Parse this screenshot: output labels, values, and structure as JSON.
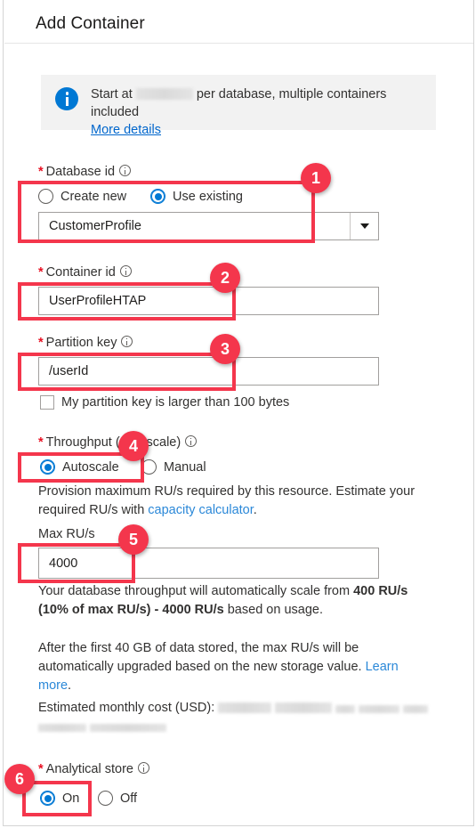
{
  "panel": {
    "title": "Add Container"
  },
  "info_banner": {
    "icon": "info-circle-icon",
    "text_before": "Start at",
    "redacted_price": "",
    "text_after": "per database, multiple containers included",
    "link_label": "More details"
  },
  "fields": {
    "database_id": {
      "label": "Database id",
      "required_marker": "*",
      "info_icon": "info-circle-icon",
      "options": [
        {
          "label": "Create new",
          "checked": false
        },
        {
          "label": "Use existing",
          "checked": true
        }
      ],
      "combo_value": "CustomerProfile",
      "combo_caret": "chevron-down-icon"
    },
    "container_id": {
      "label": "Container id",
      "required_marker": "*",
      "info_icon": "info-circle-icon",
      "value": "UserProfileHTAP"
    },
    "partition_key": {
      "label": "Partition key",
      "required_marker": "*",
      "info_icon": "info-circle-icon",
      "value": "/userId",
      "checkbox_label": "My partition key is larger than 100 bytes",
      "checkbox_checked": false
    },
    "throughput": {
      "label": "Throughput (Autoscale)",
      "required_marker": "*",
      "info_icon": "info-circle-icon",
      "options": [
        {
          "label": "Autoscale",
          "checked": true
        },
        {
          "label": "Manual",
          "checked": false
        }
      ],
      "helper_before": "Provision maximum RU/s required by this resource. Estimate your required RU/s with ",
      "helper_link": "capacity calculator",
      "helper_after": "."
    },
    "max_rus": {
      "label": "Max RU/s",
      "value": "4000",
      "helper_1": "Your database throughput will automatically scale from ",
      "helper_1_bold": "400 RU/s (10% of max RU/s) - 4000 RU/s",
      "helper_1_after": " based on usage.",
      "helper_2": "After the first 40 GB of data stored, the max RU/s will be automatically upgraded based on the new storage value. ",
      "helper_2_link": "Learn more",
      "helper_2_after": ".",
      "cost_label": "Estimated monthly cost (USD):",
      "cost_value_redacted": ""
    },
    "analytical_store": {
      "label": "Analytical store",
      "required_marker": "*",
      "info_icon": "info-circle-icon",
      "options": [
        {
          "label": "On",
          "checked": true
        },
        {
          "label": "Off",
          "checked": false
        }
      ]
    }
  },
  "annotations": {
    "accent_color": "#f4364c",
    "markers": [
      {
        "number": "1",
        "target": "database-id-group"
      },
      {
        "number": "2",
        "target": "container-id-input"
      },
      {
        "number": "3",
        "target": "partition-key-input"
      },
      {
        "number": "4",
        "target": "throughput-autoscale-radio"
      },
      {
        "number": "5",
        "target": "max-rus-input"
      },
      {
        "number": "6",
        "target": "analytical-store-on-radio"
      }
    ]
  }
}
